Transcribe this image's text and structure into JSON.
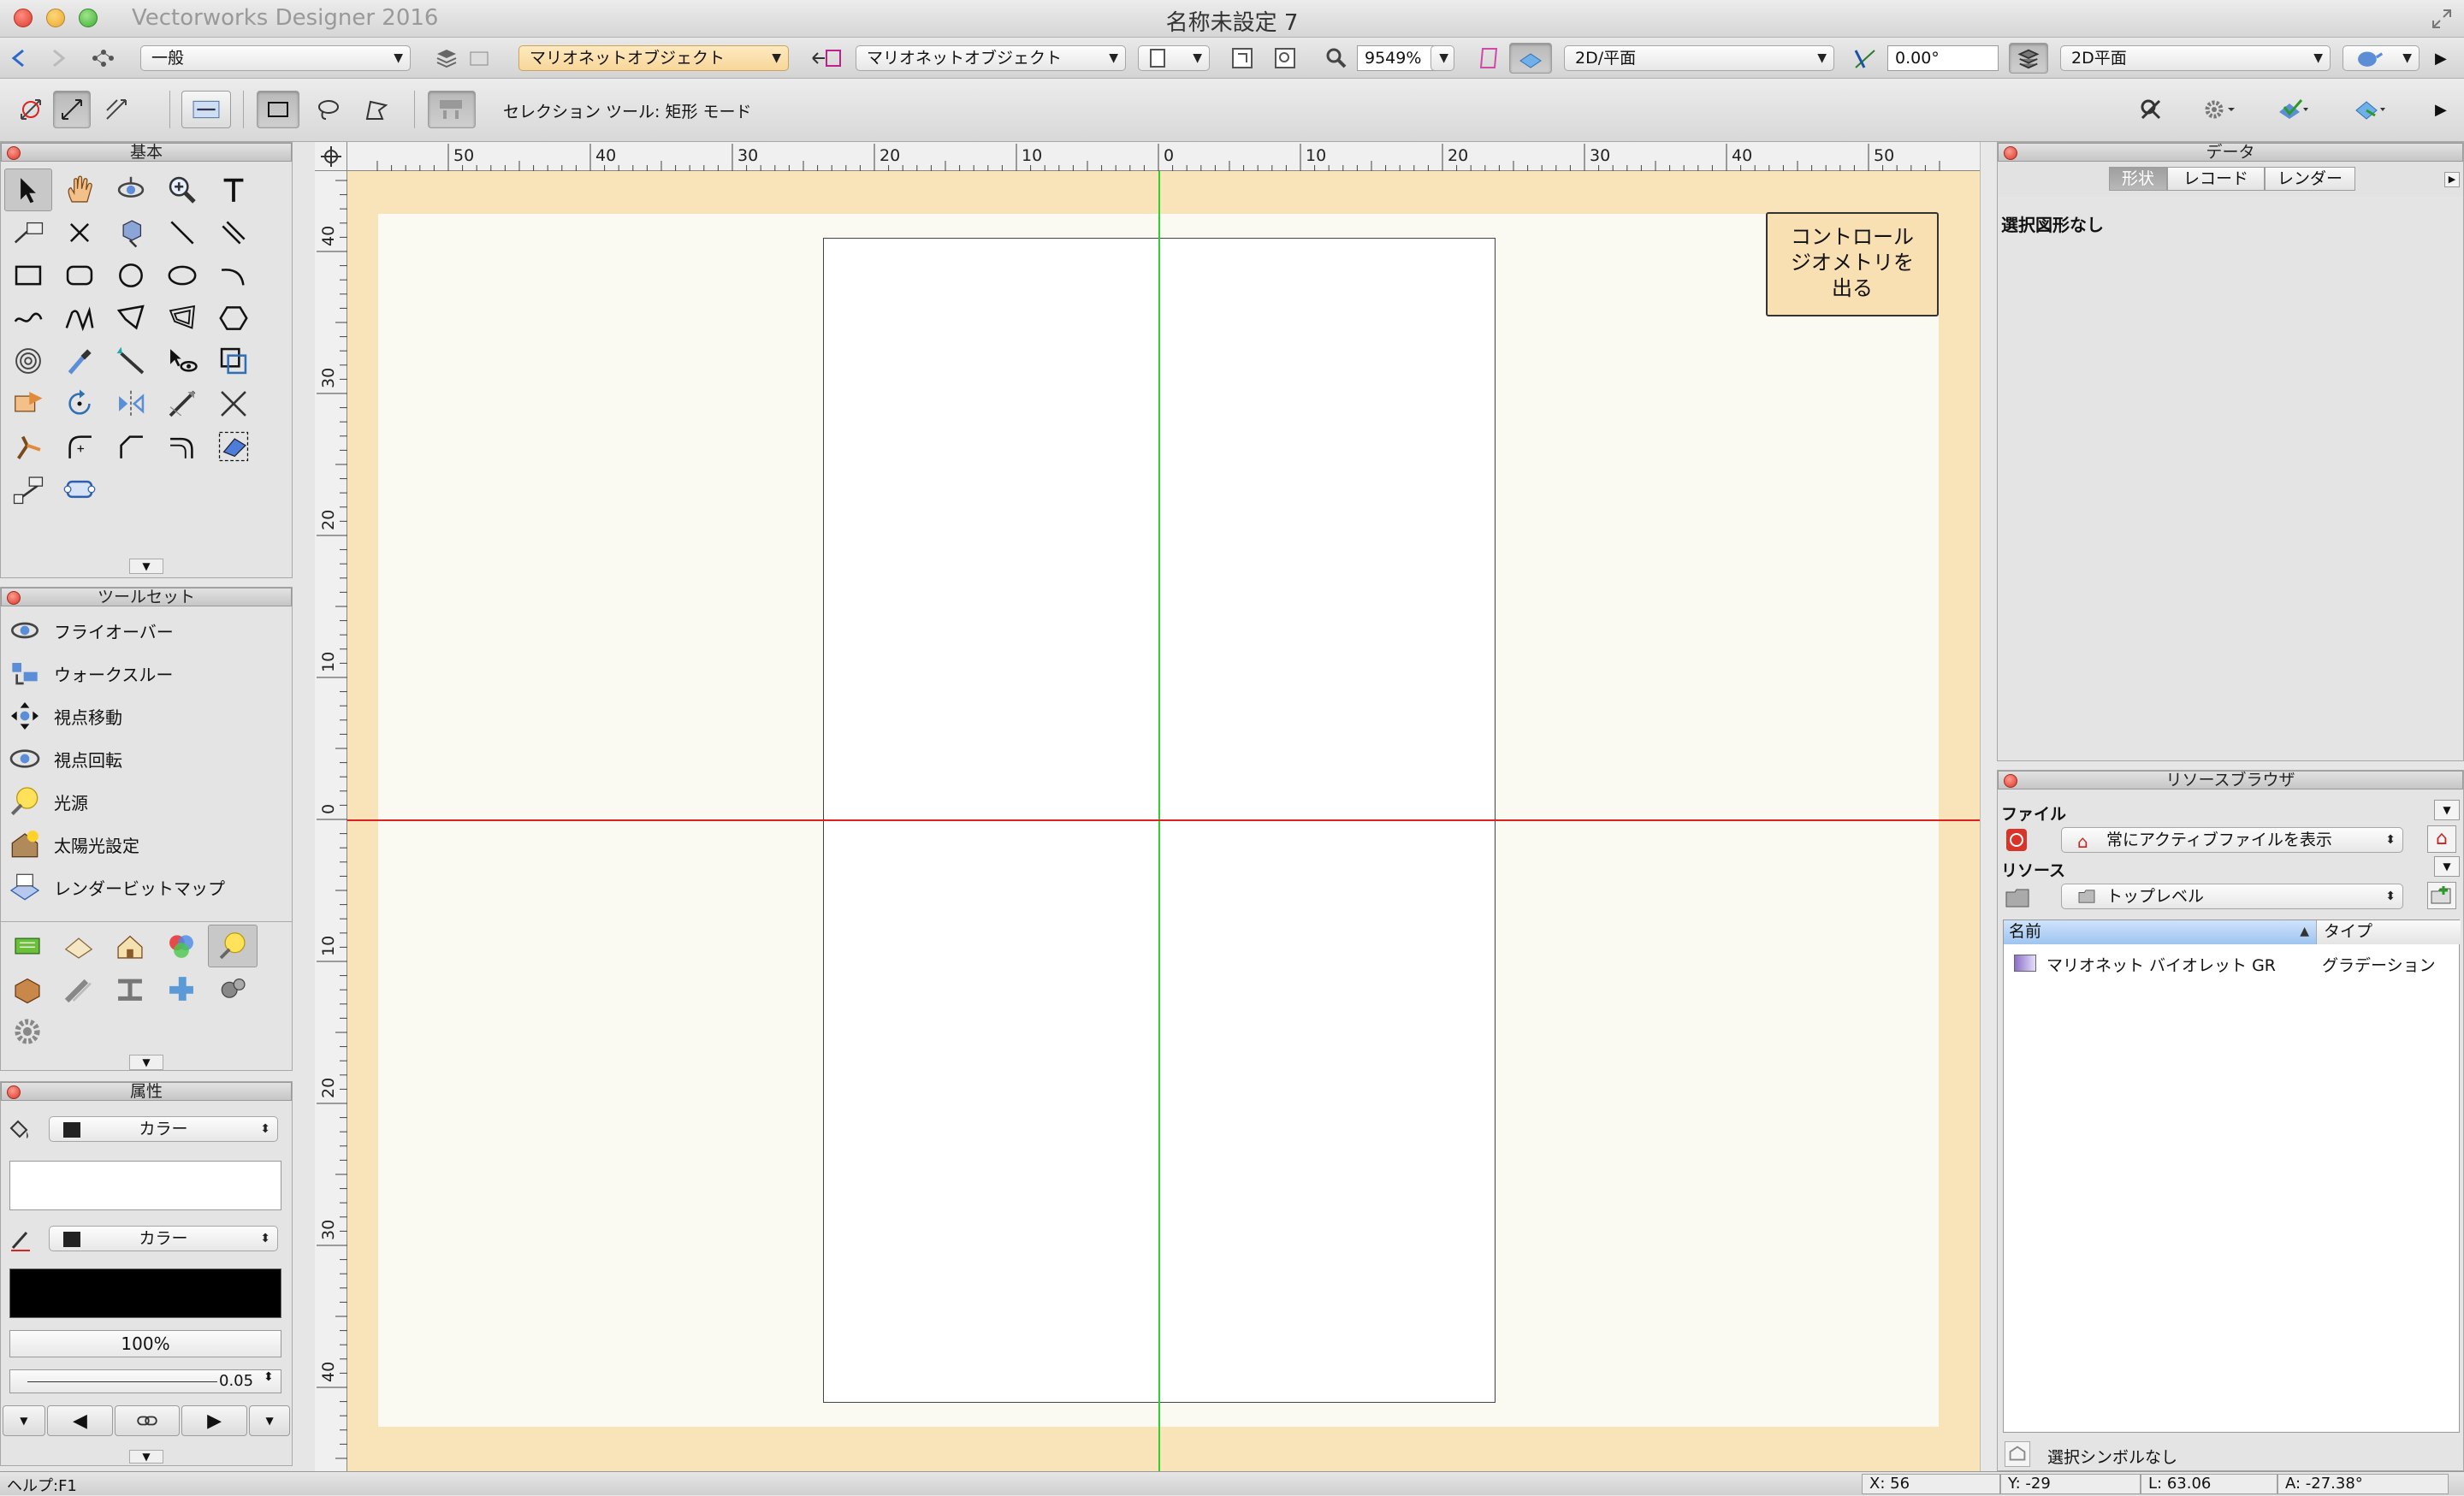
{
  "window": {
    "app_title": "Vectorworks Designer 2016",
    "doc_title": "名称未設定 7"
  },
  "toolbar1": {
    "class_popup": "一般",
    "layer_popup": "マリオネットオブジェクト",
    "object_popup": "マリオネットオブジェクト",
    "zoom_value": "9549%",
    "view_popup": "2D/平面",
    "angle_value": "0.00°",
    "render_popup": "2D平面"
  },
  "toolbar2": {
    "mode_label": "セレクション ツール: 矩形 モード"
  },
  "basic_palette": {
    "title": "基本"
  },
  "toolset_palette": {
    "title": "ツールセット",
    "items": [
      {
        "label": "フライオーバー",
        "icon": "flyover-icon"
      },
      {
        "label": "ウォークスルー",
        "icon": "walkthrough-icon"
      },
      {
        "label": "視点移動",
        "icon": "pan-view-icon"
      },
      {
        "label": "視点回転",
        "icon": "rotate-view-icon"
      },
      {
        "label": "光源",
        "icon": "light-source-icon"
      },
      {
        "label": "太陽光設定",
        "icon": "sun-setting-icon"
      },
      {
        "label": "レンダービットマップ",
        "icon": "render-bitmap-icon"
      }
    ]
  },
  "attributes_palette": {
    "title": "属性",
    "fill_popup": "カラー",
    "pen_popup": "カラー",
    "opacity": "100%",
    "line_weight": "0.05"
  },
  "ruler": {
    "top_labels": [
      "50",
      "40",
      "30",
      "20",
      "10",
      "0",
      "10",
      "20",
      "30",
      "40",
      "50"
    ],
    "left_labels": [
      "40",
      "30",
      "20",
      "10",
      "0",
      "10",
      "20",
      "30",
      "40"
    ]
  },
  "canvas": {
    "note": "コントロール\nジオメトリを\n出る"
  },
  "data_palette": {
    "title": "データ",
    "tabs": [
      "形状",
      "レコード",
      "レンダー"
    ],
    "active_tab": 0,
    "empty_text": "選択図形なし"
  },
  "resource_browser": {
    "title": "リソースブラウザ",
    "file_label": "ファイル",
    "file_popup": "常にアクティブファイルを表示",
    "resource_label": "リソース",
    "resource_popup": "トップレベル",
    "col_name": "名前",
    "col_type": "タイプ",
    "rows": [
      {
        "name": "マリオネット バイオレット GR",
        "type": "グラデーション"
      }
    ],
    "footer": "選択シンボルなし"
  },
  "status": {
    "help": "ヘルプ:F1",
    "x": "X:  56",
    "y": "Y:  -29",
    "l": "L:  63.06",
    "a": "A:  -27.38°"
  },
  "colors": {
    "canvas_margin": "#f8e4b8",
    "page": "#fafaf2",
    "x_axis": "#e02020",
    "y_axis": "#30d030"
  }
}
